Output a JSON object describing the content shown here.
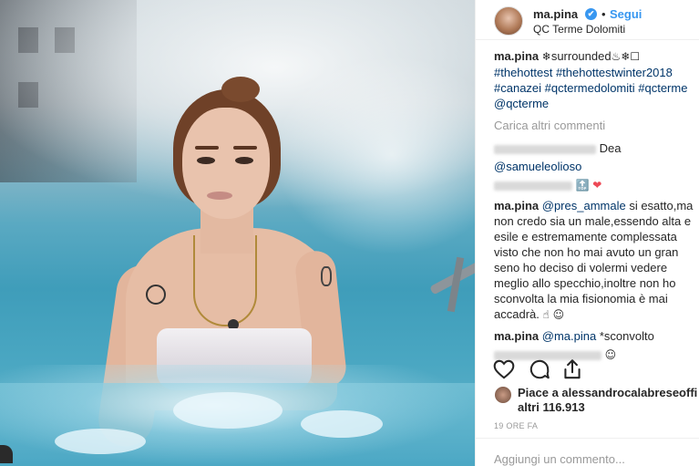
{
  "post": {
    "username": "ma.pina",
    "verified_mark": "✔",
    "separator": "•",
    "follow_label": "Segui",
    "location": "QC Terme Dolomiti"
  },
  "caption": {
    "user": "ma.pina",
    "text_start": "surrounded",
    "hashtags_line1": "#thehottest #thehottestwinter2018",
    "hashtags_line2": "#canazei #qctermedolomiti #qcterme",
    "mention": "@qcterme"
  },
  "load_more": "Carica altri commenti",
  "comments": [
    {
      "user": "",
      "text": "Dea"
    },
    {
      "user": "",
      "text": "@samueleolioso"
    },
    {
      "user": "ma.pina",
      "mention": "@pres_ammale",
      "text": "si esatto,ma non credo sia un male,essendo alta e esile e estremamente complessata visto che non ho mai avuto un gran seno ho deciso di volermi vedere meglio allo specchio,inoltre non ho sconvolta la mia fisionomia è mai accadrà."
    },
    {
      "user": "ma.pina",
      "mention": "@ma.pina",
      "text": "*sconvolto"
    }
  ],
  "actions": {
    "like_icon": "heart-outline-icon",
    "comment_icon": "comment-bubble-icon",
    "share_icon": "share-icon"
  },
  "likes": {
    "prefix": "Piace a alessandrocalabreseoffi",
    "count": "altri 116.913"
  },
  "timestamp": "19 ORE FA",
  "add_comment_placeholder": "Aggiungi un commento...",
  "colors": {
    "link_blue": "#3897f0",
    "hashtag": "#003569",
    "muted": "#999999",
    "heart": "#ed4956"
  }
}
